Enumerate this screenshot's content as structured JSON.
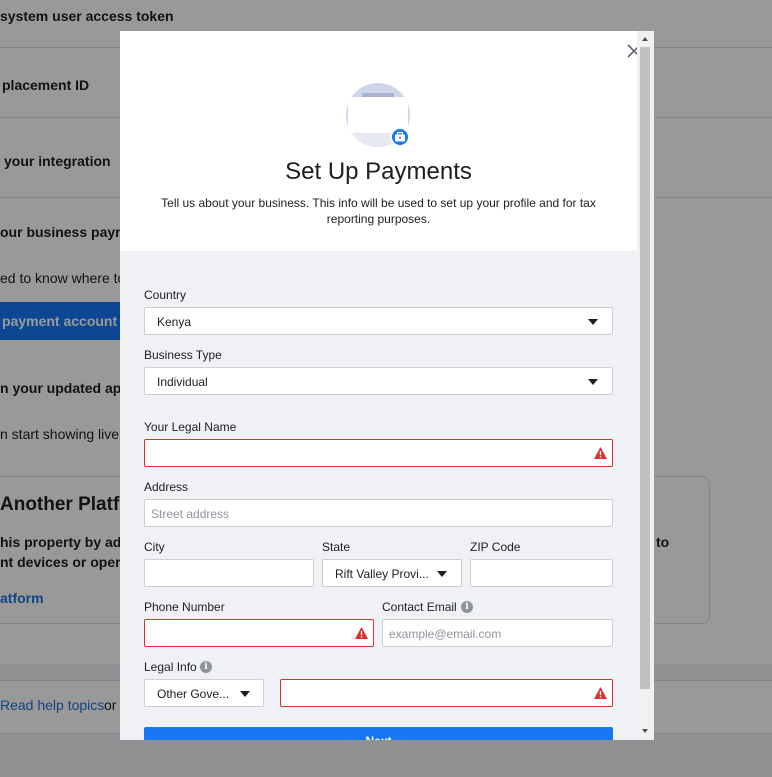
{
  "background": {
    "rows": [
      "system user access token",
      "placement ID",
      "your integration"
    ],
    "business_payment_heading": "our business payme",
    "business_payment_text": "ed to know where to",
    "payment_account_button": "payment account",
    "updated_app_heading": "n your updated app",
    "live_text": "n start showing live a",
    "platform_heading": "Another Platform",
    "platform_text_1": "his property by addi",
    "platform_text_2": "nt devices or operat",
    "platform_link": "atform",
    "right_fragment": "to",
    "help_link": "Read help topics",
    "help_or": "or"
  },
  "modal": {
    "title": "Set Up Payments",
    "subtitle": "Tell us about your business. This info will be used to set up your profile and for tax reporting purposes.",
    "country": {
      "label": "Country",
      "value": "Kenya"
    },
    "business_type": {
      "label": "Business Type",
      "value": "Individual"
    },
    "legal_name": {
      "label": "Your Legal Name",
      "value": ""
    },
    "address": {
      "label": "Address",
      "placeholder": "Street address"
    },
    "city": {
      "label": "City",
      "value": ""
    },
    "state": {
      "label": "State",
      "value": "Rift Valley Provi..."
    },
    "zip": {
      "label": "ZIP Code",
      "value": ""
    },
    "phone": {
      "label": "Phone Number",
      "value": ""
    },
    "contact_email": {
      "label": "Contact Email",
      "placeholder": "example@email.com"
    },
    "legal_info": {
      "label": "Legal Info",
      "type_value": "Other Gove...",
      "value": ""
    },
    "next_label": "Next"
  },
  "colors": {
    "accent": "#1877f2",
    "error": "#e02e2a",
    "form_bg": "#f0f1f4"
  }
}
